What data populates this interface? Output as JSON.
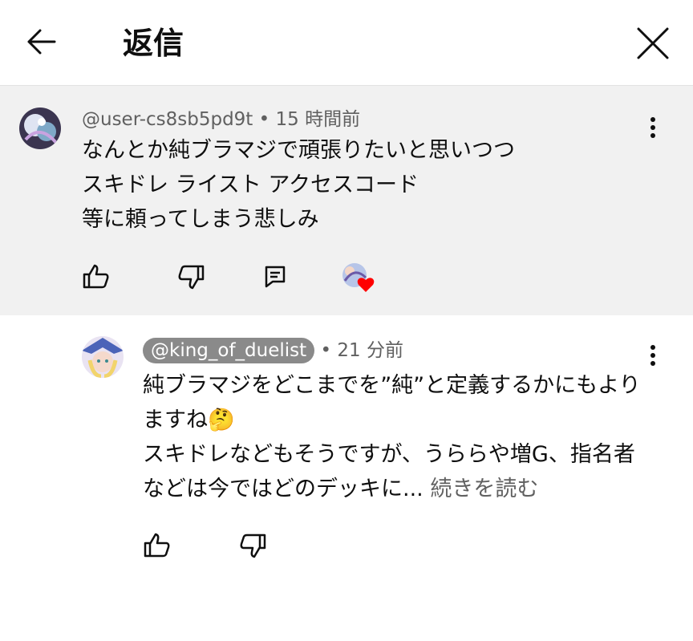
{
  "header": {
    "title": "返信"
  },
  "parent_comment": {
    "author": "@user-cs8sb5pd9t",
    "separator": "•",
    "time": "15 時間前",
    "body": "なんとか純ブラマジで頑張りたいと思いつつ\nスキドレ ライスト アクセスコード\n等に頼ってしまう悲しみ"
  },
  "reply": {
    "author": "@king_of_duelist",
    "separator": "•",
    "time": "21 分前",
    "body": "純ブラマジをどこまでを”純”と定義するかにもよりますね🤔\nスキドレなどもそうですが、うららや増G、指名者などは今ではどのデッキに...",
    "read_more": "続きを読む"
  },
  "colors": {
    "parent_background": "#f1f1f1",
    "secondary_text": "#606060",
    "heart": "#ff0000",
    "author_chip": "#8a8a8a"
  },
  "icons": [
    "back-arrow-icon",
    "close-icon",
    "more-vert-icon",
    "like-icon",
    "dislike-icon",
    "reply-icon",
    "heart-icon"
  ]
}
